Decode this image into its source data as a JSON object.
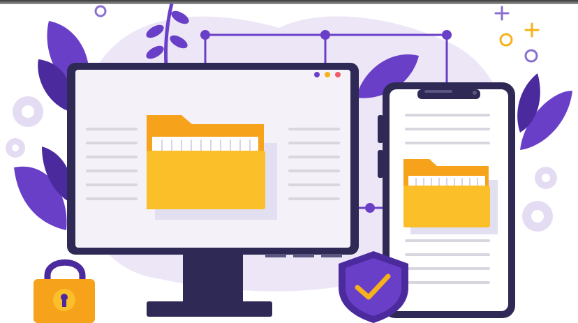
{
  "colors": {
    "background": "#ffffff",
    "blob": "#ece6f6",
    "purple_dark": "#4b2a9e",
    "purple_mid": "#6a3fc8",
    "purple_light": "#b9a6e6",
    "navy": "#2e2a55",
    "screen": "#f4f2f8",
    "folder_back": "#f6a21a",
    "folder_front": "#fbbf2a",
    "lock_body": "#f6a21a",
    "shield": "#5b34b5",
    "check": "#f6b21a",
    "gear": "#e3dcf3",
    "line_gray": "#d8d6de",
    "accent_red": "#f05a6a",
    "accent_yellow": "#f6b21a"
  },
  "icons": {
    "monitor": "desktop-monitor-icon",
    "phone": "smartphone-icon",
    "folder": "folder-icon",
    "lock": "padlock-icon",
    "shield": "shield-check-icon",
    "gear": "gear-icon",
    "plant": "leaf-icon"
  }
}
